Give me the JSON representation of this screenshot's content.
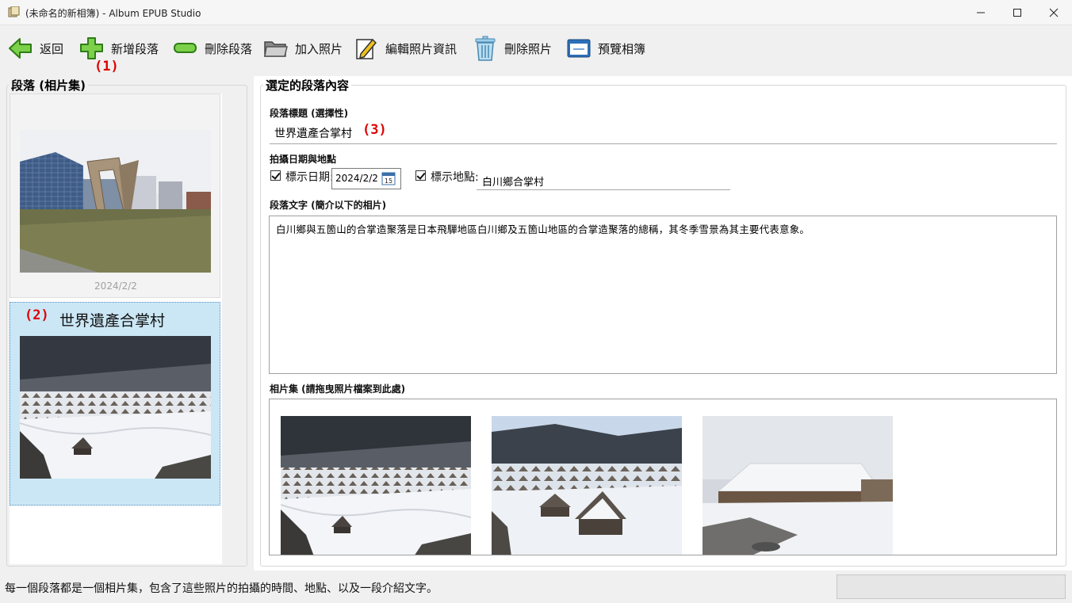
{
  "window": {
    "title": "(未命名的新相簿) - Album EPUB Studio",
    "controls": [
      "minimize-icon",
      "maximize-icon",
      "close-icon"
    ]
  },
  "toolbar": {
    "back_label": "返回",
    "add_section_label": "新增段落",
    "delete_section_label": "刪除段落",
    "add_photo_label": "加入照片",
    "edit_photo_label": "編輯照片資訊",
    "delete_photo_label": "刪除照片",
    "preview_label": "預覽相簿",
    "icons": [
      "back-arrow-icon",
      "plus-icon",
      "minus-icon",
      "folder-icon",
      "pencil-note-icon",
      "trash-icon",
      "preview-window-icon"
    ]
  },
  "annotations": {
    "mark1": "(1)",
    "mark2": "(2)",
    "mark3": "(3)"
  },
  "left_panel": {
    "legend": "段落 (相片集)",
    "cards": [
      {
        "title": "",
        "date": "2024/2/2"
      },
      {
        "title": "世界遺產合掌村",
        "selected": true
      }
    ]
  },
  "right_panel": {
    "legend": "選定的段落內容",
    "section_title_label": "段落標題 (選擇性)",
    "section_title_value": "世界遺產合掌村",
    "datetime_location_label": "拍攝日期與地點",
    "show_date_label": "標示日期:",
    "date_value": "2024/2/2",
    "calendar_icon_text": "15",
    "show_location_label": "標示地點:",
    "location_value": "白川鄉合掌村",
    "section_text_label": "段落文字 (簡介以下的相片)",
    "section_text_value": "白川鄉與五箇山的合掌造聚落是日本飛驒地區白川鄉及五箇山地區的合掌造聚落的總稱，其冬季雪景為其主要代表意象。",
    "photos_label": "相片集 (請拖曳照片檔案到此處)",
    "photos_count": 3
  },
  "status": {
    "text": "每一個段落都是一個相片集，包含了這些照片的拍攝的時間、地點、以及一段介紹文字。"
  },
  "colors": {
    "accent_red": "#e00000",
    "selected_card": "#cbe7f6"
  }
}
